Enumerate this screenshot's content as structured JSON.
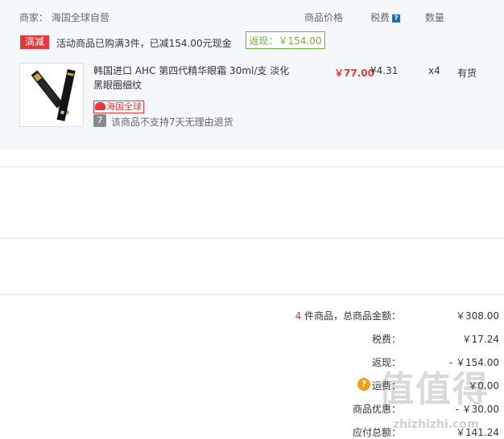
{
  "order": {
    "merchant_label": "商家：",
    "merchant_name": "海国全球自营",
    "col_price": "商品价格",
    "col_tax": "税费",
    "tax_help": "?",
    "col_qty": "数量",
    "promo_tag": "满减",
    "promo_text": "活动商品已购满3件，已减154.00元现金",
    "cashback_text": "返现：￥154.00",
    "item": {
      "name": "韩国进口 AHC 第四代精华眼霜 30ml/支 淡化黑眼圈细纹",
      "price": "￥77.00",
      "tax": "¥4.31",
      "qty": "x4",
      "stock": "有货",
      "badge": "海国全球",
      "return_icon": "7",
      "return_policy": "该商品不支持7天无理由退货"
    }
  },
  "summary": {
    "count": "4",
    "count_suffix": "件商品，总商品金额：",
    "total": "￥308.00",
    "tax_label": "税费：",
    "tax_value": "￥17.24",
    "cashback_label": "返现：",
    "cashback_value": "- ￥154.00",
    "shipping_help": "?",
    "shipping_label": "运费：",
    "shipping_value": "￥0.00",
    "discount_label": "商品优惠：",
    "discount_value": "- ￥30.00",
    "payable_label": "应付总额：",
    "payable_value": "￥141.24"
  },
  "watermark": {
    "main": "值值得",
    "sub": "zhizhizhi.com"
  },
  "colors": {
    "accent_red": "#e4393c",
    "green": "#6cb33e",
    "orange": "#f39c12",
    "blue": "#1e6fba"
  }
}
